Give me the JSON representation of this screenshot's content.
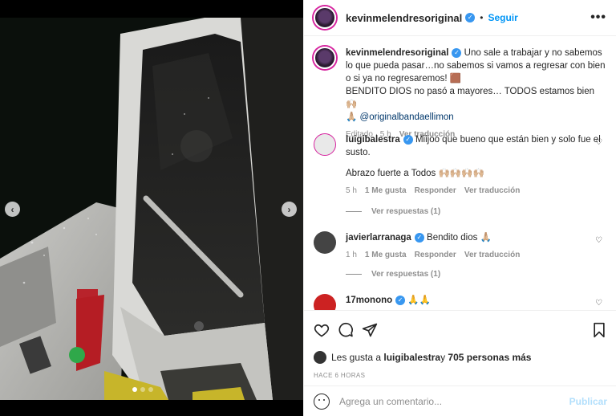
{
  "header": {
    "username": "kevinmelendresoriginal",
    "follow_label": "Seguir",
    "more_label": "•••"
  },
  "caption": {
    "username": "kevinmelendresoriginal",
    "text": "Uno sale a trabajar y no sabemos lo que pueda pasar…no sabemos si vamos a regresar con bien o si ya no regresaremos! 🟫",
    "text2": "BENDITO DIOS no pasó a mayores… TODOS estamos bien 🙌🏼",
    "text3": "🙏🏼",
    "mention": "@originalbandaellimon",
    "edited": "Editado · 5 h",
    "translate": "Ver traducción"
  },
  "comments": [
    {
      "username": "luigibalestra",
      "text": "Miijoo que bueno que están bien y solo fue el susto.",
      "text2": "Abrazo fuerte a Todos 🙌🏼🙌🏼🙌🏼🙌🏼",
      "time": "5 h",
      "likes": "1 Me gusta",
      "reply": "Responder",
      "translate": "Ver traducción",
      "replies": "Ver respuestas (1)"
    },
    {
      "username": "javierlarranaga",
      "text": "Bendito dios 🙏🏼",
      "time": "1 h",
      "likes": "1 Me gusta",
      "reply": "Responder",
      "translate": "Ver traducción",
      "replies": "Ver respuestas (1)"
    },
    {
      "username": "17monono",
      "text": "🙏🙏"
    }
  ],
  "likes": {
    "prefix": "Les gusta a ",
    "user": "luigibalestra",
    "mid": " y ",
    "count": "705 personas más"
  },
  "timestamp": "HACE 6 HORAS",
  "add_comment": {
    "placeholder": "Agrega un comentario...",
    "publish": "Publicar"
  },
  "media": {
    "prev": "‹",
    "next": "›"
  }
}
